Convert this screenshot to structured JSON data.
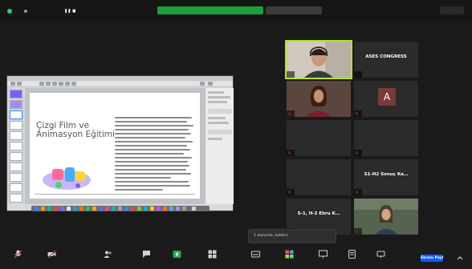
{
  "topbar": {
    "meeting_id": "",
    "recording_banner": "",
    "view_label": "",
    "fullscreen_label": ""
  },
  "document": {
    "title_line1": "Çizgi Film ve",
    "title_line2": "Animasyon Eğitimi"
  },
  "tiles": [
    {
      "name": "",
      "label": "",
      "kind": "video",
      "speaking": true
    },
    {
      "name": "",
      "label": "ASES CONGRESS",
      "kind": "label"
    },
    {
      "name": "",
      "label": "",
      "kind": "video"
    },
    {
      "name": "",
      "label": "",
      "kind": "avatar",
      "initial": "A"
    },
    {
      "name": "",
      "label": "",
      "kind": "label"
    },
    {
      "name": "",
      "label": "",
      "kind": "label"
    },
    {
      "name": "",
      "label": "",
      "kind": "label"
    },
    {
      "name": "",
      "label": "S1-H2 Sonuç Ka…",
      "kind": "label"
    },
    {
      "name": "",
      "label": "S-1, H-2 Ebru K…",
      "kind": "label"
    },
    {
      "name": "",
      "label": "",
      "kind": "video"
    }
  ],
  "chat_bubble": {
    "text": "",
    "lines": [
      "1 alanında",
      "kaldırın"
    ]
  },
  "bottom_toolbar": {
    "buttons": [
      {
        "label": "",
        "icon": "microphone-icon"
      },
      {
        "label": "",
        "icon": "video-camera-icon"
      },
      {
        "label": "",
        "icon": "participants-icon"
      },
      {
        "label": "",
        "icon": "chat-icon"
      },
      {
        "label": "",
        "icon": "share-screen-icon"
      },
      {
        "label": "",
        "icon": "breakout-icon"
      },
      {
        "label": "",
        "icon": "captions-icon"
      },
      {
        "label": "",
        "icon": "apps-icon"
      },
      {
        "label": "",
        "icon": "whiteboard-icon"
      },
      {
        "label": "",
        "icon": "notes-icon"
      },
      {
        "label": "",
        "icon": "more-icon"
      }
    ],
    "share_label": "Ekranı Paylaş"
  },
  "colors": {
    "speaker_outline": "#b6e61e",
    "recording_green": "#1f9d3f",
    "share_blue": "#0b5cff",
    "mic_off_red": "#e54848"
  }
}
